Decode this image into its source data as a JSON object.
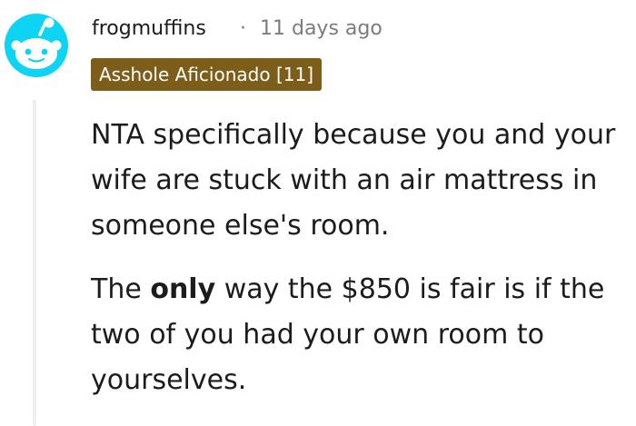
{
  "comment": {
    "author": "frogmuffins",
    "separator": "·",
    "timestamp": "11 days ago",
    "flair": "Asshole Aficionado [11]",
    "paragraph1": "NTA specifically because you and your wife are stuck with an air mattress in someone else's room.",
    "paragraph2": {
      "before": "The ",
      "bold": "only",
      "after": " way the $850 is fair is if the two of you had your own room to yourselves."
    }
  },
  "colors": {
    "flair_background": "#7d5d1a",
    "avatar_blue": "#0dd3f4",
    "meta_text": "#7c7c7c",
    "thread_line": "#edeff1"
  },
  "icons": {
    "avatar": "reddit-snoo-icon"
  }
}
